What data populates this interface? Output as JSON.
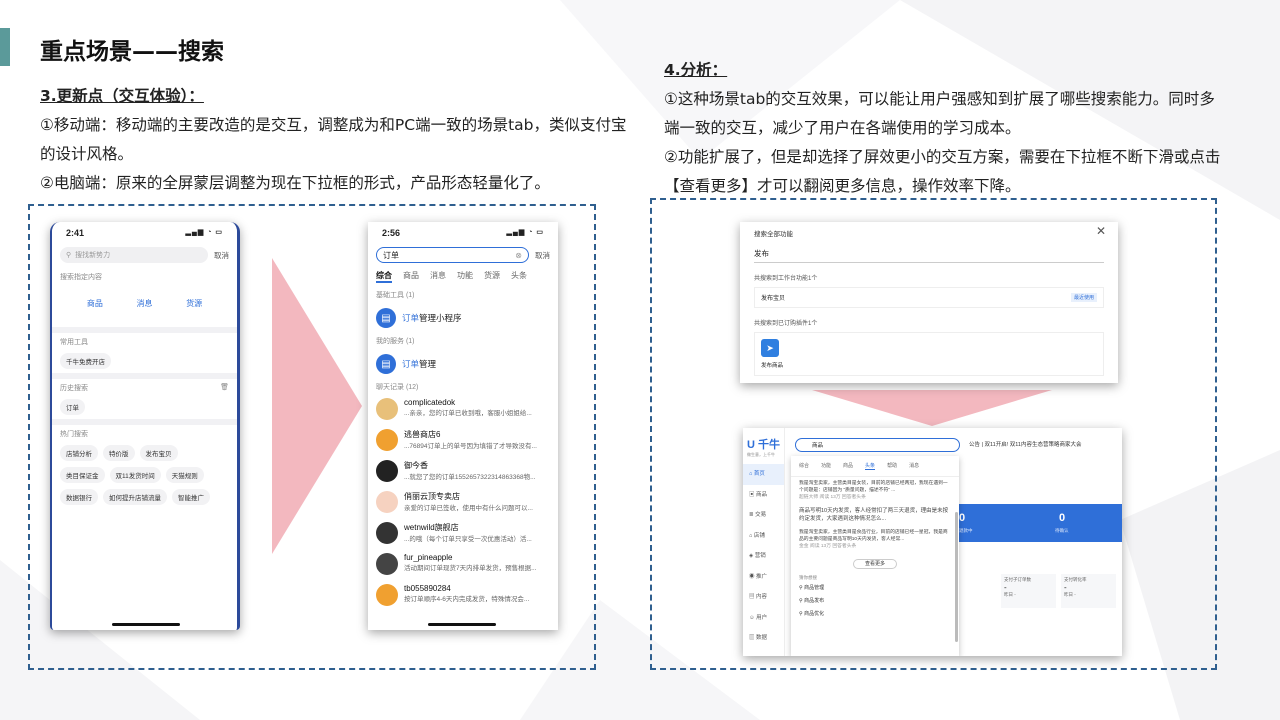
{
  "slide": {
    "title": "重点场景——搜索",
    "left": {
      "heading": "3.更新点（交互体验）：",
      "p1": "①移动端：移动端的主要改造的是交互，调整成为和PC端一致的场景tab，类似支付宝的设计风格。",
      "p2": "②电脑端：原来的全屏蒙层调整为现在下拉框的形式，产品形态轻量化了。"
    },
    "right": {
      "heading": "4.分析：",
      "p1": "①这种场景tab的交互效果，可以能让用户强感知到扩展了哪些搜索能力。同时多端一致的交互，减少了用户在各端使用的学习成本。",
      "p2": "②功能扩展了，但是却选择了屏效更小的交互方案，需要在下拉框不断下滑或点击【查看更多】才可以翻阅更多信息，操作效率下降。"
    }
  },
  "colors": {
    "accent": "#5b9a9a",
    "dash": "#2f5f8f",
    "arrow": "#f3b8bf",
    "brand": "#2f6fd8"
  },
  "phone1": {
    "time": "2:41",
    "search_placeholder": "搜找新势力",
    "cancel": "取消",
    "scope_title": "搜索指定内容",
    "scope_tabs": [
      "商品",
      "消息",
      "货源"
    ],
    "tools_title": "常用工具",
    "tools": [
      "千牛免费开店"
    ],
    "history_title": "历史搜索",
    "history": [
      "订单"
    ],
    "hot_title": "热门搜索",
    "hot_row1": [
      "店铺分析",
      "特价版",
      "发布宝贝"
    ],
    "hot_row2": [
      "类目保证金",
      "双11发货时间",
      "天猫规则"
    ],
    "hot_row3": [
      "数据银行",
      "如何提升店铺流量",
      "智能推广"
    ]
  },
  "phone2": {
    "time": "2:56",
    "search_value": "订单",
    "cancel": "取消",
    "tabs": [
      "综合",
      "商品",
      "消息",
      "功能",
      "货源",
      "头条"
    ],
    "basic_tools": "基础工具 (1)",
    "tool_hl": "订单",
    "tool_rest": "管理小程序",
    "my_services": "我的服务 (1)",
    "service_hl": "订单",
    "service_rest": "管理",
    "chat_title": "聊天记录 (12)",
    "chats": [
      {
        "name": "complicatedok",
        "msg": "...亲亲，您的订单已收到哦，客服小姐姐给...",
        "color": "#e8c07a"
      },
      {
        "name": "逃兽商店6",
        "msg": "...76894订单上的单号因为填错了才导致没有...",
        "color": "#f0a030"
      },
      {
        "name": "御今香",
        "msg": "...就您了您的订单1552657322314863368物...",
        "color": "#222222"
      },
      {
        "name": "俏丽云顶专卖店",
        "msg": "亲爱的订单已签收，使用中有什么问题可以...",
        "color": "#f6d2c0"
      },
      {
        "name": "wetnwild旗舰店",
        "msg": "...的哦（每个订单只享受一次优惠活动）活...",
        "color": "#333333"
      },
      {
        "name": "fur_pineapple",
        "msg": "活动期间订单现货7天内排单发货，预售根据...",
        "color": "#444444"
      },
      {
        "name": "tb055890284",
        "msg": "按订单顺序4-6天内完成发货，特殊情况会...",
        "color": "#f0a030"
      }
    ]
  },
  "dialog": {
    "title": "搜索全部功能",
    "input": "发布",
    "found_tools": "共搜索到工作台功能1个",
    "tool_item": "发布宝贝",
    "tool_tag": "最近使用",
    "found_plugins": "共搜索到已订购插件1个",
    "plugin_item": "发布商品"
  },
  "qianniu": {
    "logo": "千牛",
    "logo_sub": "做生意，上千牛",
    "nav": [
      "首页",
      "商品",
      "交易",
      "店铺",
      "营销",
      "推广",
      "内容",
      "用户",
      "数据"
    ],
    "search_value": "商品",
    "notice": "公告 | 双11开启! 双11内容生态营策略商家大会",
    "tabs": [
      "综合",
      "功能",
      "商品",
      "头条",
      "帮助",
      "消息"
    ],
    "result1": "我是淘宝卖家，主营类目是女装，目前的店铺已经两冠，我现在遇到一个问题是：店铺因为 “质量问题，描述不符” ...",
    "result1_meta": "超链大师  阅读 13万  回答者头条",
    "result2": "商品写明10天内发货，客人经常扣了两三天退货，理由是未按约定发货，大家遇到这种情况怎么...",
    "result3": "我是淘宝卖家，主营类目是食品行业，目前的店铺已经一星冠，我是商品的主要问题是商品写明10天内发货，客人经常...",
    "result3_meta": "金金  阅读 13万  回答者头条",
    "more": "查看更多",
    "related": "猜你想搜",
    "links": [
      "商品管理",
      "商品发布",
      "商品优化"
    ],
    "big_nums": [
      "0",
      "0"
    ],
    "big_num_labels": [
      "退款中",
      "待确认"
    ],
    "stats": [
      "支付子订单数",
      "支付转化率"
    ],
    "stat_dash": "-",
    "stat_sub": "昨日 -"
  }
}
